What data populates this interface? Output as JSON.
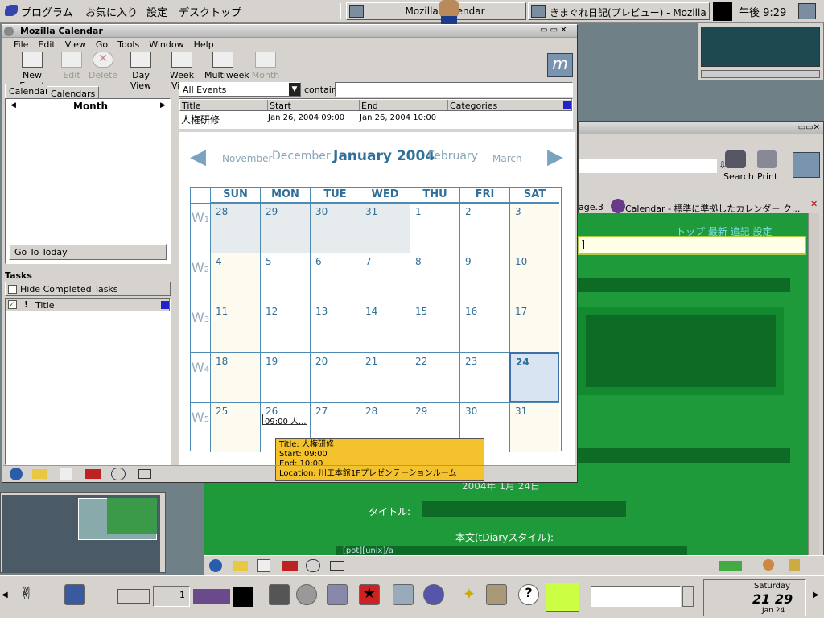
{
  "top_panel": {
    "programs": "プログラム",
    "favorites": "お気に入り",
    "settings": "設定",
    "desktop": "デスクトップ",
    "task1": "Mozilla Calendar",
    "task2": "きまぐれ日記(プレビュー) - Mozilla",
    "clock": "午後 9:29"
  },
  "window": {
    "title": "Mozilla Calendar"
  },
  "menu": [
    "File",
    "Edit",
    "View",
    "Go",
    "Tools",
    "Window",
    "Help"
  ],
  "toolbar": {
    "new_event": "New Event",
    "edit": "Edit",
    "delete": "Delete",
    "day_view": "Day View",
    "week_view": "Week View",
    "multiweek": "Multiweek",
    "month_view": "Month View"
  },
  "sidebar": {
    "tab_calendar": "Calendar",
    "tab_calendars": "Calendars",
    "month_label": "Month",
    "go_today": "Go To Today",
    "tasks_heading": "Tasks",
    "hide_completed": "Hide Completed Tasks",
    "task_col_title": "Title"
  },
  "filter": {
    "selected": "All Events",
    "contain_label": "contain",
    "search_value": ""
  },
  "event_list": {
    "headers": [
      "Title",
      "Start",
      "End",
      "Categories"
    ],
    "rows": [
      {
        "title": "人権研修",
        "start": "Jan 26, 2004 09:00",
        "end": "Jan 26, 2004 10:00",
        "categories": ""
      }
    ]
  },
  "month_nav": {
    "prev2": "November",
    "prev1": "December",
    "current": "January 2004",
    "next1": "February",
    "next2": "March"
  },
  "days": [
    "SUN",
    "MON",
    "TUE",
    "WED",
    "THU",
    "FRI",
    "SAT"
  ],
  "weeks": [
    {
      "w": "1",
      "d": [
        "28",
        "29",
        "30",
        "31",
        "1",
        "2",
        "3"
      ]
    },
    {
      "w": "2",
      "d": [
        "4",
        "5",
        "6",
        "7",
        "8",
        "9",
        "10"
      ]
    },
    {
      "w": "3",
      "d": [
        "11",
        "12",
        "13",
        "14",
        "15",
        "16",
        "17"
      ]
    },
    {
      "w": "4",
      "d": [
        "18",
        "19",
        "20",
        "21",
        "22",
        "23",
        "24"
      ]
    },
    {
      "w": "5",
      "d": [
        "25",
        "26",
        "27",
        "28",
        "29",
        "30",
        "31"
      ]
    }
  ],
  "event_chip": "09:00 人...",
  "tooltip": {
    "title": "Title: 人権研修",
    "start": "Start: 09:00",
    "end": "End: 10:00",
    "location": "Location: 川工本館1Fプレゼンテーションルーム"
  },
  "browser": {
    "search": "Search",
    "print": "Print",
    "tab_partial": "age.3",
    "tab2": "Calendar - 標準に準拠したカレンダー ク...",
    "links": "トップ 最新 追記 設定",
    "date_line": "2004年 1月 24日",
    "title_label": "タイトル:",
    "body_label": "本文(tDiaryスタイル):",
    "body_text": "[pot][unix]/a"
  },
  "bottom_panel": {
    "workspace": "1",
    "clock_day": "Saturday",
    "clock_time": "21 29",
    "clock_date": "Jan 24"
  }
}
